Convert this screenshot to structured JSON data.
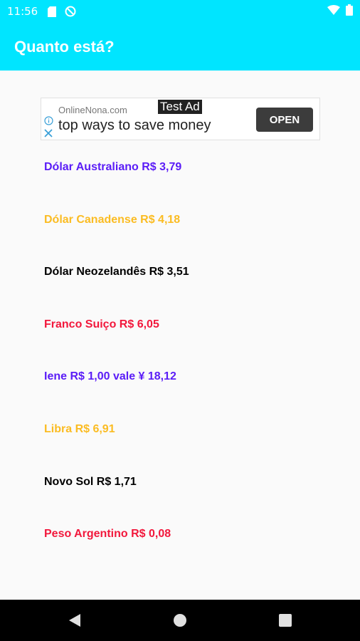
{
  "status_bar": {
    "time": "11:56",
    "icons": [
      "sd-card-icon",
      "no-disturb-icon",
      "wifi-icon",
      "battery-icon"
    ]
  },
  "app_bar": {
    "title": "Quanto está?",
    "color": "#00e5ff"
  },
  "ad": {
    "label": "Test Ad",
    "domain": "OnlineNona.com",
    "headline": "top ways to save money",
    "cta": "OPEN"
  },
  "rates": [
    {
      "text": "Dólar Australiano R$ 3,79",
      "color": "#5b1df7"
    },
    {
      "text": "Dólar Canadense R$ 4,18",
      "color": "#fbbc22"
    },
    {
      "text": "Dólar Neozelandês R$ 3,51",
      "color": "#000000"
    },
    {
      "text": "Franco Suiço R$ 6,05",
      "color": "#f2183c"
    },
    {
      "text": "Iene R$ 1,00 vale ¥ 18,12",
      "color": "#5b1df7"
    },
    {
      "text": "Libra R$ 6,91",
      "color": "#fbbc22"
    },
    {
      "text": "Novo Sol R$ 1,71",
      "color": "#000000"
    },
    {
      "text": "Peso Argentino R$ 0,08",
      "color": "#f2183c"
    }
  ],
  "nav": {
    "icons": [
      "back-icon",
      "home-icon",
      "recents-icon"
    ]
  }
}
